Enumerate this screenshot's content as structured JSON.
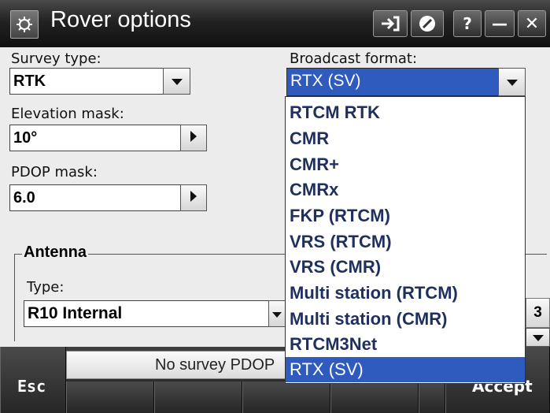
{
  "window": {
    "title": "Rover options",
    "buttons": [
      {
        "name": "connect-icon"
      },
      {
        "name": "no-entry-icon"
      },
      {
        "label": "?"
      },
      {
        "label": "—"
      },
      {
        "label": "✕"
      }
    ]
  },
  "form": {
    "survey_type": {
      "label": "Survey type:",
      "value": "RTK"
    },
    "elevation_mask": {
      "label": "Elevation mask:",
      "value": "10°"
    },
    "pdop_mask": {
      "label": "PDOP mask:",
      "value": "6.0"
    },
    "broadcast_format": {
      "label": "Broadcast format:",
      "value": "RTX (SV)"
    }
  },
  "antenna": {
    "group_label": "Antenna",
    "type_label": "Type:",
    "type_value": "R10 Internal",
    "page_indicator": "3"
  },
  "dropdown": {
    "options": [
      "RTCM RTK",
      "CMR",
      "CMR+",
      "CMRx",
      "FKP (RTCM)",
      "VRS (RTCM)",
      "VRS (CMR)",
      "Multi station (RTCM)",
      "Multi station (CMR)",
      "RTCM3Net",
      "RTX (SV)"
    ],
    "selected": "RTX (SV)"
  },
  "status": {
    "text": "No survey PDOP"
  },
  "softkeys": {
    "esc": "Esc",
    "accept": "Accept"
  },
  "colors": {
    "selection": "#2e5bbd",
    "titlebar": "#1a1a1a",
    "option_text": "#1f2f5e"
  }
}
